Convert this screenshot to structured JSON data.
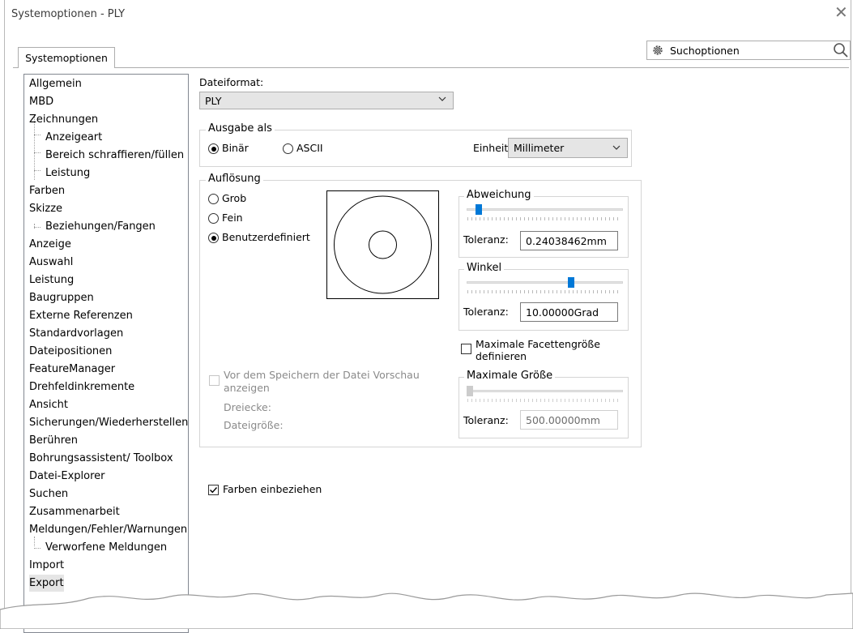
{
  "window": {
    "title": "Systemoptionen - PLY",
    "close_glyph": "✕"
  },
  "tab": {
    "label": "Systemoptionen"
  },
  "search": {
    "label": "Suchoptionen",
    "icon": "gear-icon",
    "search_icon": "magnifier-icon"
  },
  "tree": {
    "items": [
      {
        "label": "Allgemein",
        "level": 0
      },
      {
        "label": "MBD",
        "level": 0
      },
      {
        "label": "Zeichnungen",
        "level": 0
      },
      {
        "label": "Anzeigeart",
        "level": 1
      },
      {
        "label": "Bereich schraffieren/füllen",
        "level": 1
      },
      {
        "label": "Leistung",
        "level": 1
      },
      {
        "label": "Farben",
        "level": 0
      },
      {
        "label": "Skizze",
        "level": 0
      },
      {
        "label": "Beziehungen/Fangen",
        "level": 1
      },
      {
        "label": "Anzeige",
        "level": 0
      },
      {
        "label": "Auswahl",
        "level": 0
      },
      {
        "label": "Leistung",
        "level": 0
      },
      {
        "label": "Baugruppen",
        "level": 0
      },
      {
        "label": "Externe Referenzen",
        "level": 0
      },
      {
        "label": "Standardvorlagen",
        "level": 0
      },
      {
        "label": "Dateipositionen",
        "level": 0
      },
      {
        "label": "FeatureManager",
        "level": 0
      },
      {
        "label": "Drehfeldinkremente",
        "level": 0
      },
      {
        "label": "Ansicht",
        "level": 0
      },
      {
        "label": "Sicherungen/Wiederherstellen",
        "level": 0
      },
      {
        "label": "Berühren",
        "level": 0
      },
      {
        "label": "Bohrungsassistent/ Toolbox",
        "level": 0
      },
      {
        "label": "Datei-Explorer",
        "level": 0
      },
      {
        "label": "Suchen",
        "level": 0
      },
      {
        "label": "Zusammenarbeit",
        "level": 0
      },
      {
        "label": "Meldungen/Fehler/Warnungen",
        "level": 0
      },
      {
        "label": "Verworfene Meldungen",
        "level": 1
      },
      {
        "label": "Import",
        "level": 0
      },
      {
        "label": "Export",
        "level": 0,
        "selected": true
      }
    ]
  },
  "dateiformat": {
    "label": "Dateiformat:",
    "value": "PLY"
  },
  "ausgabe": {
    "title": "Ausgabe als",
    "binaer": {
      "label": "Binär",
      "selected": true
    },
    "ascii": {
      "label": "ASCII",
      "selected": false
    },
    "einheit_label": "Einheit:",
    "einheit_value": "Millimeter"
  },
  "aufloesung": {
    "title": "Auflösung",
    "grob": {
      "label": "Grob",
      "selected": false
    },
    "fein": {
      "label": "Fein",
      "selected": false
    },
    "benutzer": {
      "label": "Benutzerdefiniert",
      "selected": true
    },
    "abweichung": {
      "title": "Abweichung",
      "toleranz_label": "Toleranz:",
      "toleranz_value": "0.24038462mm"
    },
    "winkel": {
      "title": "Winkel",
      "toleranz_label": "Toleranz:",
      "toleranz_value": "10.00000Grad"
    },
    "max_facette": {
      "label_line1": "Maximale Facettengröße",
      "label_line2": "definieren",
      "checked": false
    },
    "max_groesse": {
      "title": "Maximale Größe",
      "toleranz_label": "Toleranz:",
      "toleranz_value": "500.00000mm"
    },
    "vorschau": {
      "label_line1": "Vor dem Speichern der Datei Vorschau",
      "label_line2": "anzeigen",
      "checked": false
    },
    "dreiecke_label": "Dreiecke:",
    "dateigroesse_label": "Dateigröße:"
  },
  "farben": {
    "label": "Farben einbeziehen",
    "checked": true
  }
}
